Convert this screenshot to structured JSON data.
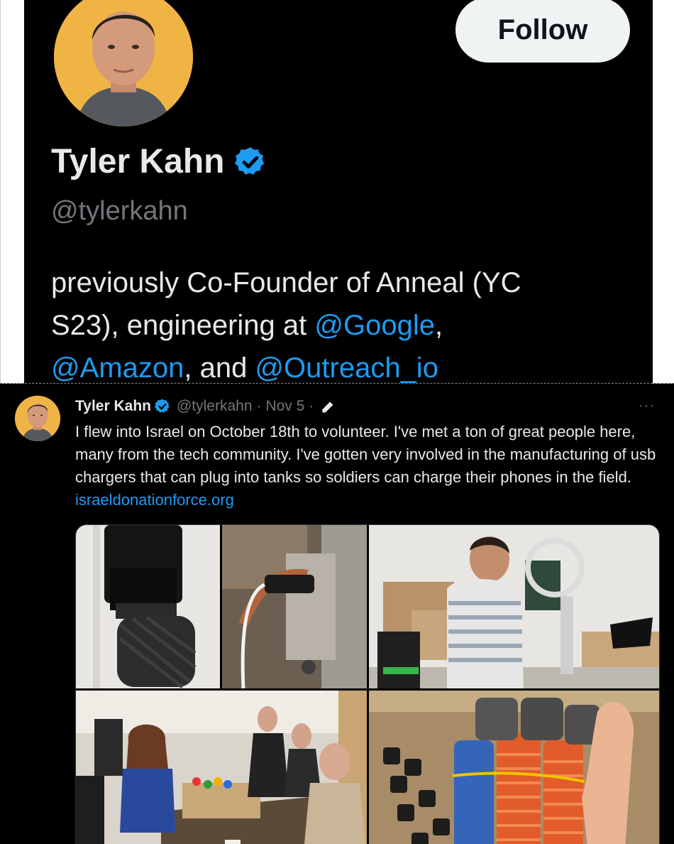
{
  "profile": {
    "display_name": "Tyler Kahn",
    "handle": "@tylerkahn",
    "follow_label": "Follow",
    "bio": {
      "line1": "previously Co-Founder of Anneal (YC",
      "line2_text": "S23), engineering at ",
      "mention_google": "@Google",
      "line2_tail": ",",
      "mention_amazon": "@Amazon",
      "and": ", and ",
      "mention_outreach": "@Outreach_io"
    }
  },
  "tweet": {
    "display_name": "Tyler Kahn",
    "handle": "@tylerkahn",
    "separator": "·",
    "date": "Nov 5",
    "more_label": "···",
    "text": "I flew into Israel on October 18th to volunteer. I've met a ton of great people here, many from the tech community. I've gotten very involved in the manufacturing of usb chargers that can plug into tanks so soldiers can charge their phones in the field. ",
    "link": "israeldonationforce.org",
    "media": [
      {
        "icon": "usb-charger-closeup-photo"
      },
      {
        "icon": "charger-in-tank-socket-photo"
      },
      {
        "icon": "man-at-drill-press-photo"
      },
      {
        "icon": "volunteers-group-table-photo"
      },
      {
        "icon": "box-of-chargers-photo"
      }
    ]
  },
  "colors": {
    "background": "#000000",
    "text": "#e7e9ea",
    "muted": "#71767b",
    "accent": "#1d9bf0",
    "verified": "#1d9bf0",
    "avatar_bg": "#f0b445"
  }
}
